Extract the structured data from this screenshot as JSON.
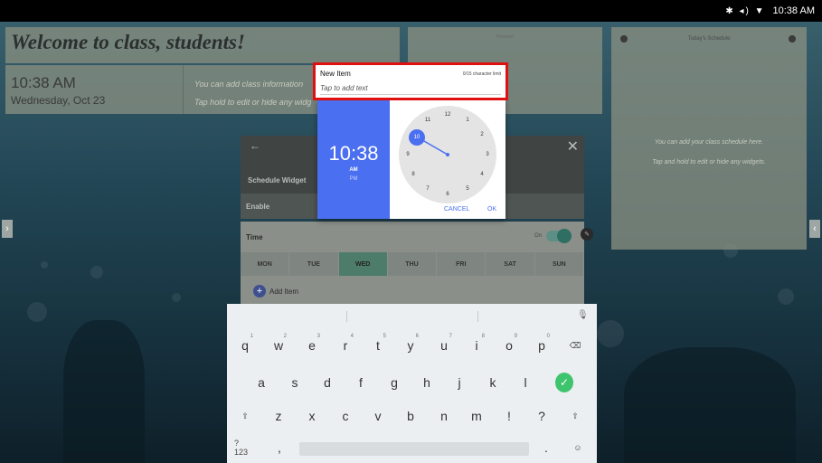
{
  "status_bar": {
    "icons": "✱ ◂) ▼",
    "time": "10:38 AM"
  },
  "welcome": {
    "title": "Welcome to class, students!"
  },
  "clock": {
    "time": "10:38 AM",
    "date": "Wednesday, Oct 23"
  },
  "info": {
    "line1": "You can add class information",
    "line2": "Tap hold to edit or hide any widg"
  },
  "notepad": {
    "title": "Notepad"
  },
  "schedule": {
    "title": "Today's Schedule",
    "line1": "You can add your class schedule here.",
    "line2": "Tap and hold to edit or hide any widgets."
  },
  "schedule_widget": {
    "back_icon": "←",
    "close_icon": "✕",
    "title": "Schedule Widget",
    "enable_label": "Enable",
    "time_label": "Time",
    "on_label": "On",
    "edit_icon": "✎",
    "days": [
      "MON",
      "TUE",
      "WED",
      "THU",
      "FRI",
      "SAT",
      "SUN"
    ],
    "active_day": "WED",
    "add_item_icon": "+",
    "add_item_label": "Add Item"
  },
  "new_item": {
    "label": "New Item",
    "char_count": "0/15 character limit",
    "placeholder": "Tap to add text"
  },
  "time_picker": {
    "time": "10:38",
    "am": "AM",
    "pm": "PM",
    "dial_numbers": [
      "12",
      "1",
      "2",
      "3",
      "4",
      "5",
      "6",
      "7",
      "8",
      "9",
      "10",
      "11"
    ],
    "selected_hour": "10",
    "cancel_label": "CANCEL",
    "ok_label": "OK"
  },
  "keyboard": {
    "mic_icon": "🎙",
    "row1": [
      "q",
      "w",
      "e",
      "r",
      "t",
      "y",
      "u",
      "i",
      "o",
      "p"
    ],
    "row1_hints": [
      "1",
      "2",
      "3",
      "4",
      "5",
      "6",
      "7",
      "8",
      "9",
      "0"
    ],
    "row2": [
      "a",
      "s",
      "d",
      "f",
      "g",
      "h",
      "j",
      "k",
      "l"
    ],
    "row3": [
      "z",
      "x",
      "c",
      "v",
      "b",
      "n",
      "m",
      "!",
      "?"
    ],
    "backspace_icon": "⌫",
    "enter_icon": "✓",
    "shift_icon": "⇧",
    "symbols_label": "?123",
    "comma": ",",
    "period": ".",
    "emoji_icon": "☺"
  }
}
